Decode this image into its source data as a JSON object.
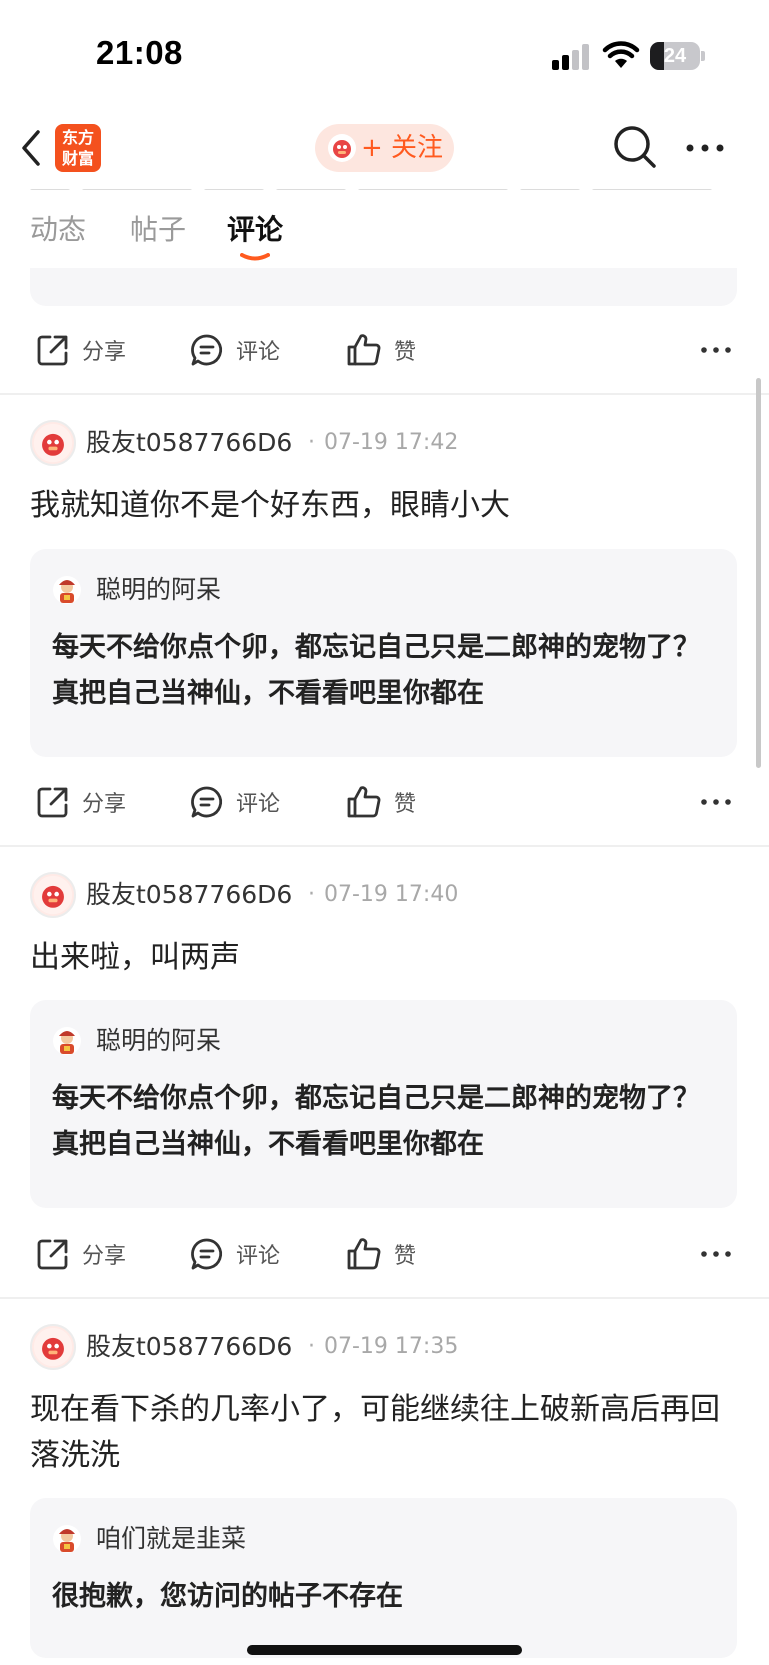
{
  "status_bar": {
    "time": "21:08",
    "battery": "24"
  },
  "nav": {
    "back_icon": "chevron-left-icon",
    "logo_text_line1": "东方",
    "logo_text_line2": "财富",
    "follow_label": "+ 关注",
    "search_icon": "search-icon",
    "more_icon": "more-horizontal-icon",
    "accent_color": "#ff5a1f"
  },
  "tabs": [
    {
      "label": "动态",
      "active": false
    },
    {
      "label": "帖子",
      "active": false
    },
    {
      "label": "评论",
      "active": true
    }
  ],
  "actions": {
    "share": "分享",
    "comment": "评论",
    "like": "赞"
  },
  "posts": [
    {
      "user": "股友t0587766D6",
      "time": "07-19 17:42",
      "text": "我就知道你不是个好东西，眼睛小大",
      "quote_user": "聪明的阿呆",
      "quote_text": "每天不给你点个卯，都忘记自己只是二郎神的宠物了？真把自己当神仙，不看看吧里你都在"
    },
    {
      "user": "股友t0587766D6",
      "time": "07-19 17:40",
      "text": "出来啦，叫两声",
      "quote_user": "聪明的阿呆",
      "quote_text": "每天不给你点个卯，都忘记自己只是二郎神的宠物了？真把自己当神仙，不看看吧里你都在"
    },
    {
      "user": "股友t0587766D6",
      "time": "07-19 17:35",
      "text": "现在看下杀的几率小了，可能继续往上破新高后再回落洗洗",
      "quote_user": "咱们就是韭菜",
      "quote_text": "很抱歉，您访问的帖子不存在"
    }
  ]
}
